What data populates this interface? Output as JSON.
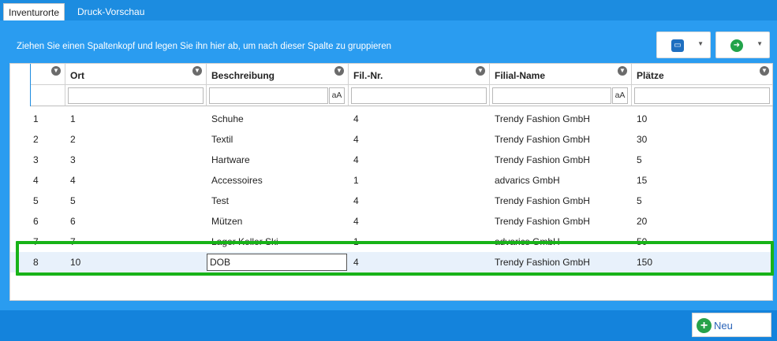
{
  "tabs": [
    {
      "label": "Inventurorte",
      "active": true
    },
    {
      "label": "Druck-Vorschau",
      "active": false
    }
  ],
  "group_hint": "Ziehen Sie einen Spaltenkopf und legen Sie ihn hier ab, um nach dieser Spalte zu gruppieren",
  "toolbar": {
    "print_icon": "printer-icon",
    "export_icon": "export-icon"
  },
  "columns": [
    {
      "key": "row",
      "label": ""
    },
    {
      "key": "ort",
      "label": "Ort"
    },
    {
      "key": "beschreibung",
      "label": "Beschreibung"
    },
    {
      "key": "filnr",
      "label": "Fil.-Nr."
    },
    {
      "key": "filialname",
      "label": "Filial-Name"
    },
    {
      "key": "plaetze",
      "label": "Plätze"
    }
  ],
  "filter": {
    "case_label": "aA"
  },
  "rows": [
    {
      "row": "1",
      "ort": "1",
      "beschreibung": "Schuhe",
      "filnr": "4",
      "filialname": "Trendy Fashion GmbH",
      "plaetze": "10"
    },
    {
      "row": "2",
      "ort": "2",
      "beschreibung": "Textil",
      "filnr": "4",
      "filialname": "Trendy Fashion GmbH",
      "plaetze": "30"
    },
    {
      "row": "3",
      "ort": "3",
      "beschreibung": "Hartware",
      "filnr": "4",
      "filialname": "Trendy Fashion GmbH",
      "plaetze": "5"
    },
    {
      "row": "4",
      "ort": "4",
      "beschreibung": "Accessoires",
      "filnr": "1",
      "filialname": "advarics GmbH",
      "plaetze": "15"
    },
    {
      "row": "5",
      "ort": "5",
      "beschreibung": "Test",
      "filnr": "4",
      "filialname": "Trendy Fashion GmbH",
      "plaetze": "5"
    },
    {
      "row": "6",
      "ort": "6",
      "beschreibung": "Mützen",
      "filnr": "4",
      "filialname": "Trendy Fashion GmbH",
      "plaetze": "20"
    },
    {
      "row": "7",
      "ort": "7",
      "beschreibung": "Lager Keller Ski",
      "filnr": "1",
      "filialname": "advarics GmbH",
      "plaetze": "50"
    },
    {
      "row": "8",
      "ort": "10",
      "beschreibung": "DOB",
      "filnr": "4",
      "filialname": "Trendy Fashion GmbH",
      "plaetze": "150"
    }
  ],
  "new_button": {
    "label": "Neu"
  },
  "colors": {
    "accent": "#1c8ce0",
    "highlight": "#18b318",
    "add": "#27a24a"
  }
}
